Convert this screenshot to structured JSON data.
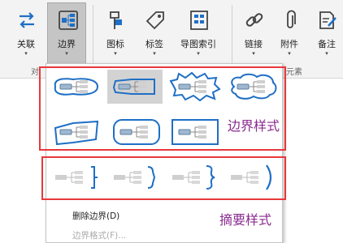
{
  "ribbon": {
    "buttons": [
      {
        "id": "relate",
        "label": "关联",
        "icon": "relationship-icon"
      },
      {
        "id": "boundary",
        "label": "边界",
        "icon": "boundary-icon",
        "active": true
      },
      {
        "id": "icon",
        "label": "图标",
        "icon": "marker-icon"
      },
      {
        "id": "tag",
        "label": "标签",
        "icon": "tag-icon"
      },
      {
        "id": "outline",
        "label": "导图索引",
        "icon": "index-icon"
      },
      {
        "id": "link",
        "label": "链接",
        "icon": "link-icon"
      },
      {
        "id": "attach",
        "label": "附件",
        "icon": "attachment-icon"
      },
      {
        "id": "note",
        "label": "备注",
        "icon": "note-icon"
      }
    ],
    "dropdown_arrow": "▾",
    "group_partial_left": "对",
    "group_partial_right": "元素"
  },
  "dropdown": {
    "boundary_styles_annotation": "边界样式",
    "summary_styles_annotation": "摘要样式",
    "boundary_styles": [
      "rounded-wave",
      "rectangle-wave-selected",
      "scallop",
      "cloud",
      "tilted-rect",
      "rounded-rect",
      "rect"
    ],
    "summary_styles": [
      "square-bracket",
      "curly-brace",
      "curly-brace-rounded",
      "parenthesis"
    ],
    "menu": {
      "delete_label": "删除边界(D)",
      "format_label": "边界格式(F)..."
    }
  },
  "colors": {
    "accent": "#1f6fc5",
    "annotation_red": "#e8383b",
    "annotation_text": "#8a2b8f"
  }
}
